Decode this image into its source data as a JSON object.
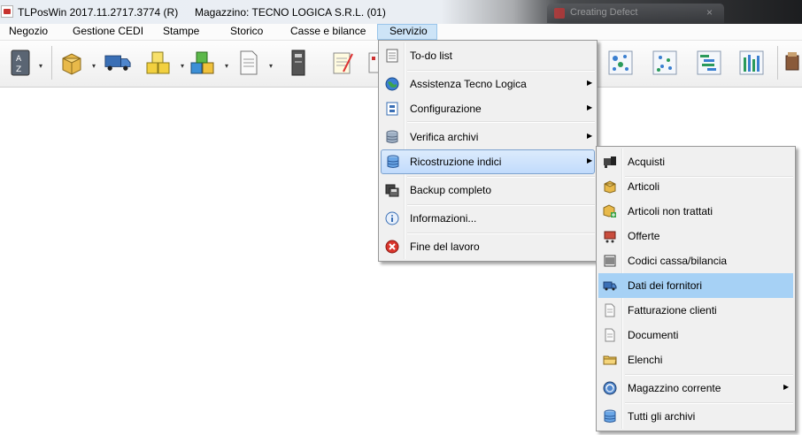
{
  "window": {
    "title": "TLPosWin 2017.11.2717.3774 (R)",
    "store": "Magazzino: TECNO LOGICA S.R.L. (01)",
    "background_tab": "Creating Defect"
  },
  "menubar": {
    "items": [
      "Negozio",
      "Gestione CEDI",
      "Stampe",
      "Storico",
      "Casse e bilance",
      "Servizio"
    ],
    "active": "Servizio"
  },
  "toolbar": {
    "buttons": [
      "sort-az-icon",
      "box-icon",
      "truck-icon",
      "boxes-icon",
      "cubes-icon",
      "document-icon",
      "archive-icon",
      "notepad-icon",
      "note-icon",
      "network-icon",
      "diagram-icon",
      "gantt-icon",
      "report-icon",
      "basket-icon"
    ]
  },
  "servizio_menu": {
    "items": [
      {
        "label": "To-do list",
        "icon": "list-icon"
      },
      {
        "label": "Assistenza Tecno Logica",
        "icon": "globe-icon",
        "submenu": true
      },
      {
        "label": "Configurazione",
        "icon": "config-icon",
        "submenu": true
      },
      {
        "label": "Verifica archivi",
        "icon": "database-icon",
        "submenu": true
      },
      {
        "label": "Ricostruzione indici",
        "icon": "database-icon",
        "submenu": true,
        "highlighted": true
      },
      {
        "label": "Backup completo",
        "icon": "backup-icon"
      },
      {
        "label": "Informazioni...",
        "icon": "info-icon"
      },
      {
        "label": "Fine del lavoro",
        "icon": "exit-icon"
      }
    ]
  },
  "ricostruzione_submenu": {
    "items": [
      {
        "label": "Acquisti",
        "icon": "barcode-icon"
      },
      {
        "label": "Articoli",
        "icon": "box-icon"
      },
      {
        "label": "Articoli non trattati",
        "icon": "box-add-icon"
      },
      {
        "label": "Offerte",
        "icon": "cart-icon"
      },
      {
        "label": "Codici cassa/bilancia",
        "icon": "scale-icon"
      },
      {
        "label": "Dati dei fornitori",
        "icon": "truck-icon",
        "highlighted": true
      },
      {
        "label": "Fatturazione clienti",
        "icon": "document-icon"
      },
      {
        "label": "Documenti",
        "icon": "document-icon"
      },
      {
        "label": "Elenchi",
        "icon": "folder-icon"
      },
      {
        "label": "Magazzino corrente",
        "icon": "warehouse-icon",
        "submenu": true
      },
      {
        "label": "Tutti gli archivi",
        "icon": "database-icon"
      }
    ]
  },
  "colors": {
    "highlight": "#c1dbfc",
    "selection": "#a6d1f5",
    "menu_bg": "#f0f0f0"
  }
}
